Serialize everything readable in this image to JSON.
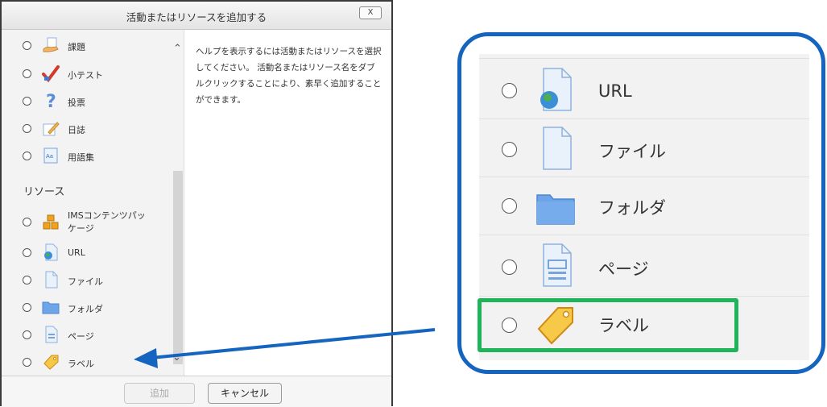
{
  "dialog": {
    "title": "活動またはリソースを追加する",
    "close_label": "X",
    "help_text": "ヘルプを表示するには活動またはリソースを選択してください。 活動名またはリソース名をダブルクリックすることにより、素早く追加することができます。",
    "section_resources": "リソース",
    "items_top": [
      {
        "label": "課題",
        "icon": "assignment-icon"
      },
      {
        "label": "小テスト",
        "icon": "quiz-icon"
      },
      {
        "label": "投票",
        "icon": "choice-icon"
      },
      {
        "label": "日誌",
        "icon": "journal-icon"
      },
      {
        "label": "用語集",
        "icon": "glossary-icon"
      }
    ],
    "items_resources": [
      {
        "label": "IMSコンテンツパッ",
        "label2": "ケージ",
        "icon": "ims-package-icon"
      },
      {
        "label": "URL",
        "icon": "url-icon"
      },
      {
        "label": "ファイル",
        "icon": "file-icon"
      },
      {
        "label": "フォルダ",
        "icon": "folder-icon"
      },
      {
        "label": "ページ",
        "icon": "page-icon"
      },
      {
        "label": "ラベル",
        "icon": "label-icon"
      }
    ],
    "add_button": "追加",
    "cancel_button": "キャンセル"
  },
  "zoom": {
    "items": [
      {
        "label": "URL",
        "icon": "url-icon"
      },
      {
        "label": "ファイル",
        "icon": "file-icon"
      },
      {
        "label": "フォルダ",
        "icon": "folder-icon"
      },
      {
        "label": "ページ",
        "icon": "page-icon"
      },
      {
        "label": "ラベル",
        "icon": "label-icon"
      }
    ]
  },
  "colors": {
    "callout_border": "#1565c0",
    "highlight": "#1fb45a",
    "arrow": "#1565c0"
  }
}
